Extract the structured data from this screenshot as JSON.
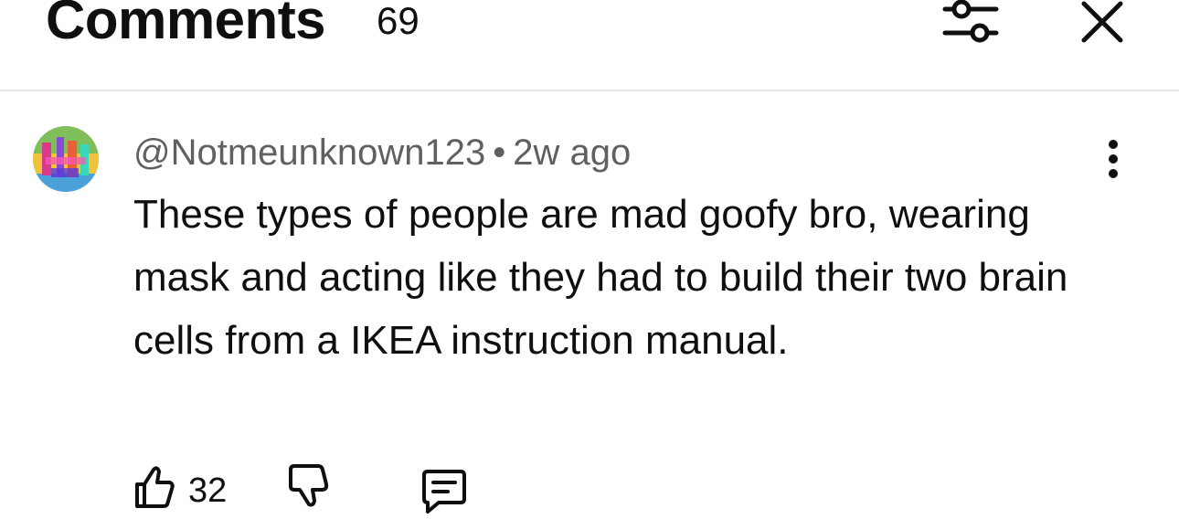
{
  "header": {
    "title": "Comments",
    "count": "69",
    "filter_icon": "sliders-icon",
    "close_icon": "close-icon"
  },
  "comment": {
    "author": "@Notmeunknown123",
    "separator": "•",
    "time": "2w ago",
    "text": "These types of people are mad goofy bro, wearing mask and acting like they had to build their two brain cells from a IKEA instruction manual.",
    "likes": "32",
    "more_icon": "more-vertical-icon",
    "like_icon": "thumbs-up-icon",
    "dislike_icon": "thumbs-down-icon",
    "reply_icon": "reply-icon"
  },
  "colors": {
    "text": "#0f0f0f",
    "secondary_text": "#606060",
    "divider": "#e5e5e5",
    "background": "#ffffff"
  }
}
